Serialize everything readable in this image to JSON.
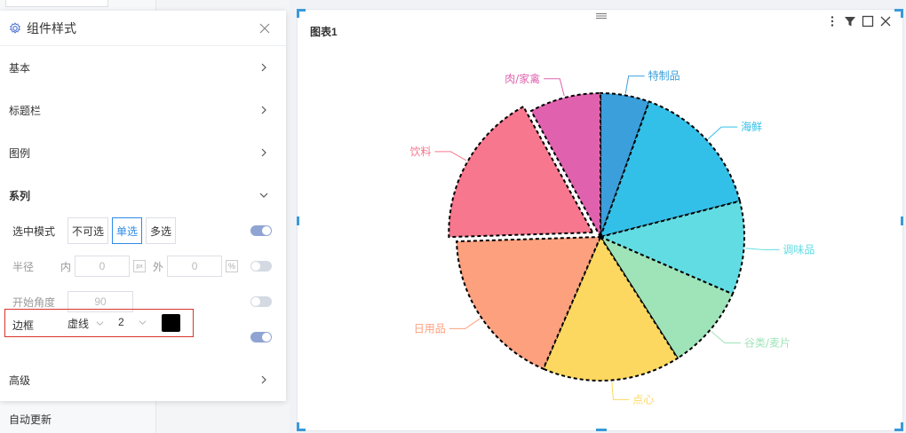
{
  "background": {
    "auto_update_label": "自动更新"
  },
  "panel": {
    "title": "组件样式",
    "icons": {
      "settings": "gear-icon",
      "close": "close-icon"
    },
    "sections": {
      "basic": "基本",
      "title_bar": "标题栏",
      "legend": "图例",
      "series": "系列",
      "advanced": "高级"
    },
    "series": {
      "select_mode": {
        "label": "选中模式",
        "options": [
          "不可选",
          "单选",
          "多选"
        ],
        "selected": "单选",
        "toggle_on": true
      },
      "radius": {
        "label": "半径",
        "inner_label": "内",
        "inner_value": "0",
        "inner_unit": "px",
        "outer_label": "外",
        "outer_value": "0",
        "outer_unit": "%",
        "toggle_on": false
      },
      "start_angle": {
        "label": "开始角度",
        "value": "90",
        "toggle_on": false
      },
      "border": {
        "label": "边框",
        "style": "虚线",
        "width": "2",
        "color": "#000000",
        "toggle_on": true
      }
    }
  },
  "canvas": {
    "chart_title": "图表1",
    "tool_icons": [
      "more-icon",
      "filter-icon",
      "maximize-icon",
      "close-icon"
    ]
  },
  "chart_data": {
    "type": "pie",
    "title": "图表1",
    "start_angle": 90,
    "border_style": "dashed",
    "border_color": "#000000",
    "selected_slice": "饮料",
    "slices": [
      {
        "name": "特制品",
        "value": 5.5,
        "color": "#3a9fdb"
      },
      {
        "name": "海鲜",
        "value": 15.5,
        "color": "#33c0e8"
      },
      {
        "name": "调味品",
        "value": 10.5,
        "color": "#62dce3"
      },
      {
        "name": "谷类/麦片",
        "value": 9.5,
        "color": "#9fe3b8"
      },
      {
        "name": "点心",
        "value": 15.5,
        "color": "#fdd860"
      },
      {
        "name": "日用品",
        "value": 18,
        "color": "#fca07e"
      },
      {
        "name": "饮料",
        "value": 17.5,
        "color": "#f6778e"
      },
      {
        "name": "肉/家禽",
        "value": 8,
        "color": "#e062ae"
      }
    ]
  }
}
